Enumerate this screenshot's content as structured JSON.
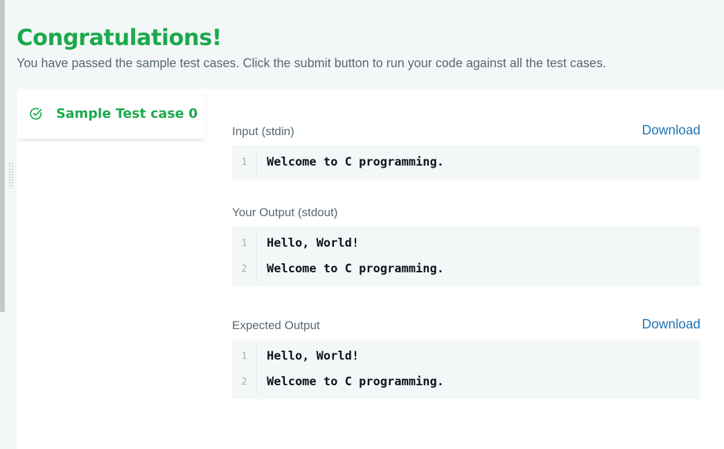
{
  "result": {
    "title": "Congratulations!",
    "message": "You have passed the sample test cases. Click the submit button to run your code against all the test cases."
  },
  "test_cases": [
    {
      "label": "Sample Test case 0",
      "status": "passed",
      "icon": "check-circle-icon"
    }
  ],
  "sections": {
    "input": {
      "label": "Input (stdin)",
      "download_label": "Download",
      "lines": [
        {
          "num": "1",
          "text": "Welcome to C programming."
        }
      ]
    },
    "output": {
      "label": "Your Output (stdout)",
      "lines": [
        {
          "num": "1",
          "text": "Hello, World!"
        },
        {
          "num": "2",
          "text": "Welcome to C programming."
        }
      ]
    },
    "expected": {
      "label": "Expected Output",
      "download_label": "Download",
      "lines": [
        {
          "num": "1",
          "text": "Hello, World!"
        },
        {
          "num": "2",
          "text": "Welcome to C programming."
        }
      ]
    }
  },
  "colors": {
    "success": "#1ba94c",
    "link": "#1f74b5",
    "muted_text": "#576871",
    "code_bg": "#f3f7f7"
  }
}
